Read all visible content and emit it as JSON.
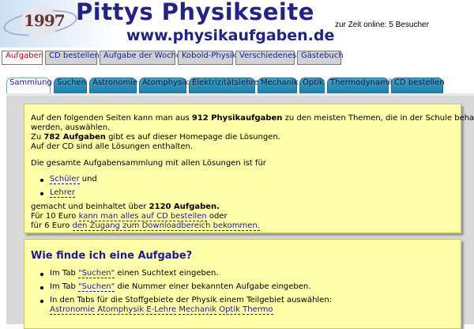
{
  "header": {
    "logo_year": "1997",
    "title": "Pittys Physikseite",
    "url": "www.physikaufgaben.de",
    "online": "zur Zeit online: 5 Besucher"
  },
  "main_tabs": [
    {
      "label": "Aufgaben",
      "active": true
    },
    {
      "label": "CD bestellen"
    },
    {
      "label": "Aufgabe der Woche"
    },
    {
      "label": "Kobold-Physik"
    },
    {
      "label": "Verschiedenes"
    },
    {
      "label": "Gästebuch"
    }
  ],
  "sub_tabs": [
    {
      "label": "Sammlung",
      "active": true
    },
    {
      "label": "Suchen"
    },
    {
      "label": "Astronomie"
    },
    {
      "label": "Atomphysik"
    },
    {
      "label": "Elektrizitätslehre"
    },
    {
      "label": "Mechanik"
    },
    {
      "label": "Optik"
    },
    {
      "label": "Thermodynamik"
    },
    {
      "label": "CD bestellen"
    }
  ],
  "intro": {
    "l1a": "Auf den folgenden Seiten kann man aus ",
    "l1b": "912 Physikaufgaben",
    "l1c": " zu den meisten Themen, die in der Schule behandelt",
    "l2": "werden, auswählen.",
    "l3a": "Zu ",
    "l3b": "782 Aufgaben",
    "l3c": " gibt es auf dieser Homepage die Lösungen.",
    "l4": "Auf der CD sind alle Lösungen enthalten.",
    "l5": "Die gesamte Aufgabensammlung mit allen Lösungen ist für",
    "item1_link": "Schüler",
    "item1_rest": " und",
    "item2_link": "Lehrer",
    "l6a": "gemacht und beinhaltet über ",
    "l6b": "2120 Aufgaben.",
    "l7a": "Für 10 Euro ",
    "l7b": "kann man alles auf CD bestellen",
    "l7c": " oder",
    "l8a": "für 6 Euro ",
    "l8b": "den Zugang zum Downloadbereich bekommen."
  },
  "howto": {
    "heading": "Wie finde ich eine Aufgabe?",
    "b1a": "Im Tab ",
    "b1link": "\"Suchen\"",
    "b1b": " einen Suchtext eingeben.",
    "b2a": "Im Tab ",
    "b2link": "\"Suchen\"",
    "b2b": " die Nummer einer bekannten Aufgabe eingeben.",
    "b3": "In den Tabs für die Stoffgebiete der Physik einem Teilgebiet auswählen:",
    "topics": [
      "Astronomie",
      "Atomphysik",
      "E-Lehre",
      "Mechanik",
      "Optik",
      "Thermo"
    ]
  }
}
